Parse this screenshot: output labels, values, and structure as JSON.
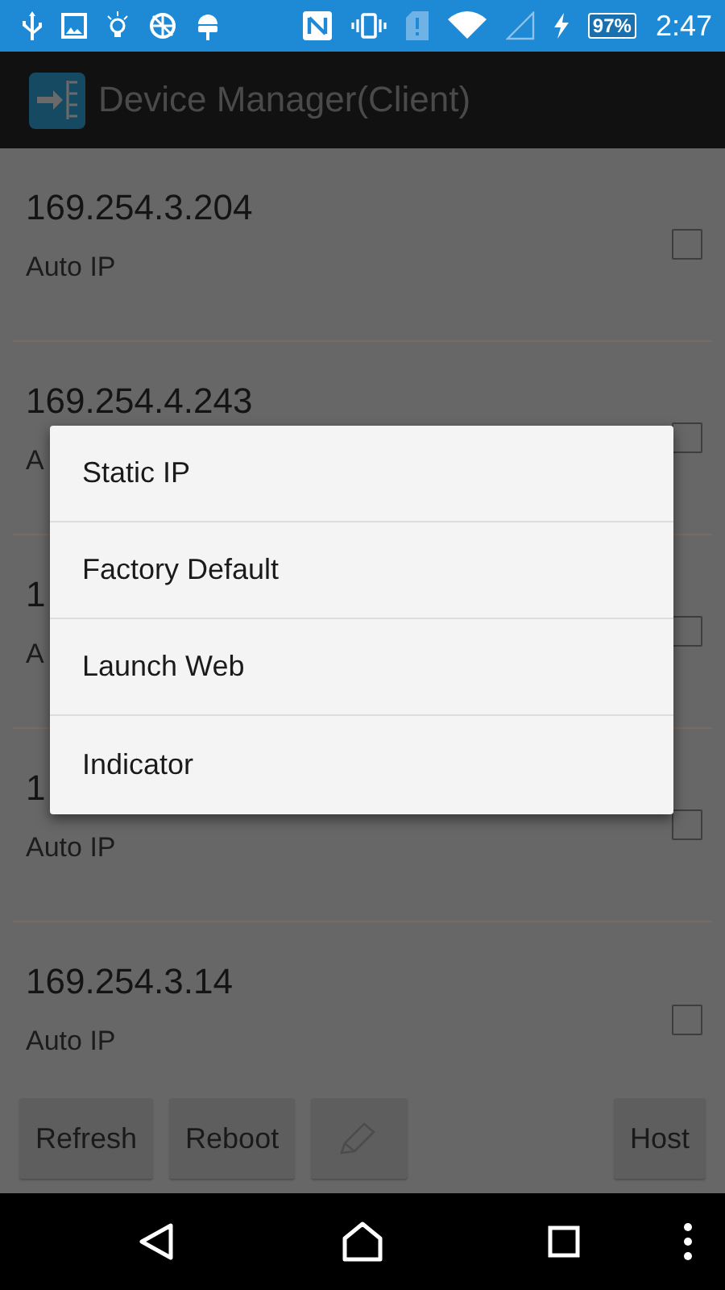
{
  "status_bar": {
    "battery": "97%",
    "time": "2:47"
  },
  "action_bar": {
    "title": "Device Manager(Client)"
  },
  "devices": [
    {
      "ip": "169.254.3.204",
      "mode": "Auto IP",
      "checked": false
    },
    {
      "ip": "169.254.4.243",
      "mode": "A",
      "checked": false
    },
    {
      "ip": "1",
      "mode": "A",
      "checked": false
    },
    {
      "ip": "1",
      "mode": "Auto IP",
      "checked": false
    },
    {
      "ip": "169.254.3.14",
      "mode": "Auto IP",
      "checked": false
    }
  ],
  "buttons": [
    {
      "kind": "text",
      "label": "Refresh",
      "disabled": false
    },
    {
      "kind": "text",
      "label": "Reboot",
      "disabled": false
    },
    {
      "kind": "edit",
      "disabled": true
    },
    {
      "kind": "spacer"
    },
    {
      "kind": "text",
      "label": "Host",
      "disabled": false
    }
  ],
  "menu": {
    "items": [
      "Static IP",
      "Factory Default",
      "Launch Web",
      "Indicator"
    ]
  }
}
